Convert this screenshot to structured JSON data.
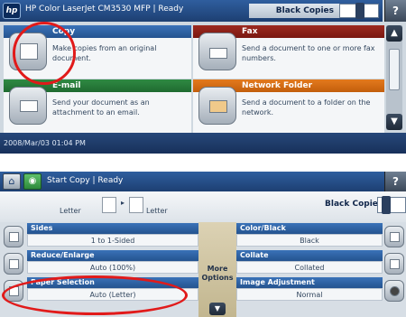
{
  "top": {
    "logo": "hp",
    "title": "HP Color LaserJet CM3530 MFP | Ready",
    "black_copies_label": "Black Copies",
    "help_label": "?",
    "tiles": [
      {
        "title": "Copy",
        "description": "Make copies from an original document.",
        "icon": "copy-icon",
        "color": "#2f63a6"
      },
      {
        "title": "Fax",
        "description": "Send a document to one or more fax numbers.",
        "icon": "fax-icon",
        "color": "#8c2219"
      },
      {
        "title": "E-mail",
        "description": "Send your document as an attachment to an email.",
        "icon": "envelope-icon",
        "color": "#27793a"
      },
      {
        "title": "Network Folder",
        "description": "Send a document to a folder on the network.",
        "icon": "folder-icon",
        "color": "#d46c14"
      }
    ],
    "scroll_up": "▲",
    "scroll_down": "▼",
    "status_datetime": "2008/Mar/03  01:04 PM"
  },
  "bottom": {
    "home_icon": "⌂",
    "start_icon": "◉",
    "title": "Start Copy | Ready",
    "help_label": "?",
    "paper_left": "Letter",
    "paper_arrow": "▸",
    "paper_right": "Letter",
    "black_copies_label": "Black Copies",
    "left_options": [
      {
        "title": "Sides",
        "value": "1 to 1-Sided",
        "icon": "sides-icon"
      },
      {
        "title": "Reduce/Enlarge",
        "value": "Auto (100%)",
        "icon": "resize-icon"
      },
      {
        "title": "Paper Selection",
        "value": "Auto (Letter)",
        "icon": "paper-icon"
      }
    ],
    "right_options": [
      {
        "title": "Color/Black",
        "value": "Black",
        "icon": "color-icon"
      },
      {
        "title": "Collate",
        "value": "Collated",
        "icon": "collate-icon"
      },
      {
        "title": "Image Adjustment",
        "value": "Normal",
        "icon": "image-adjust-icon"
      }
    ],
    "more_options_line1": "More",
    "more_options_line2": "Options",
    "more_options_arrow": "▼"
  }
}
